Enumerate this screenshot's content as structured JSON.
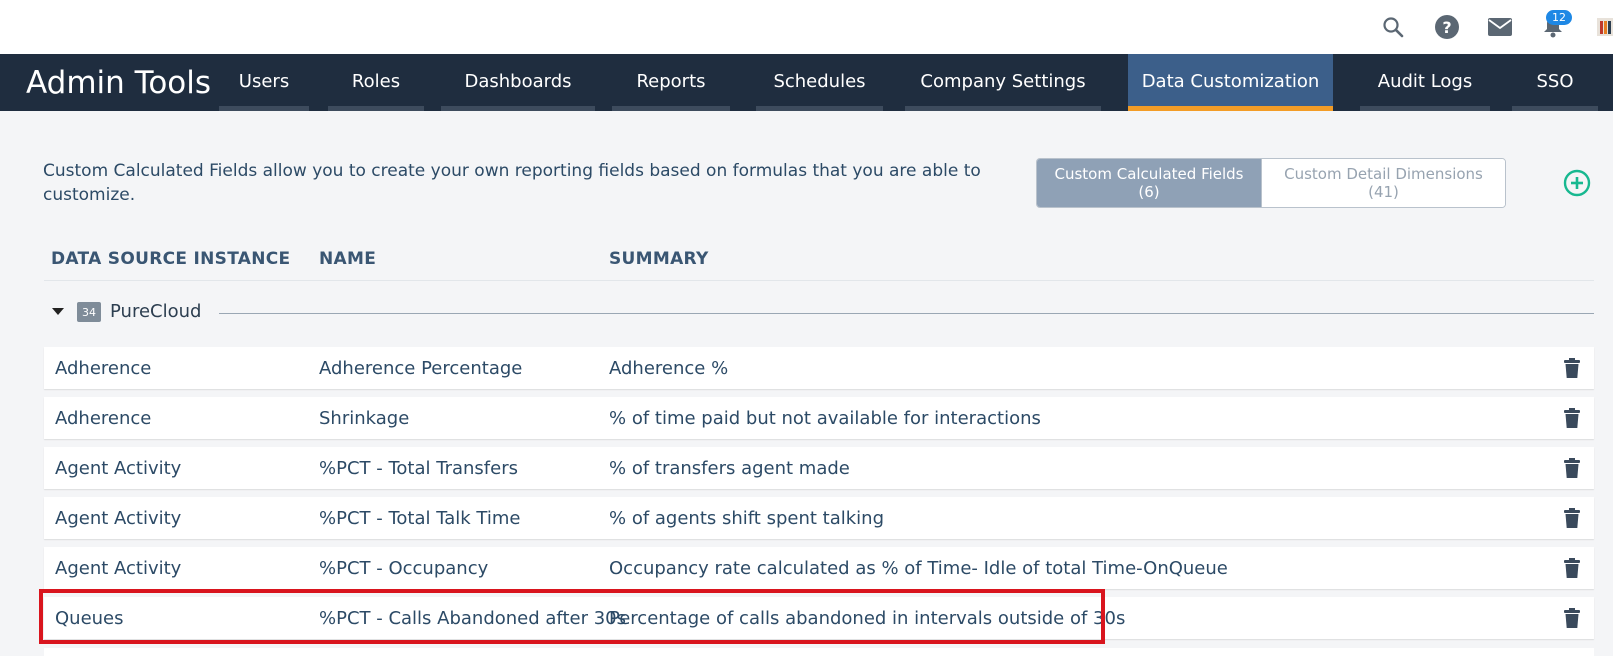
{
  "top_bar": {
    "icons": [
      "search-icon",
      "help-icon",
      "mail-icon",
      "bell-icon"
    ],
    "help_glyph": "?",
    "notification_count": "12"
  },
  "nav": {
    "app_title": "Admin Tools",
    "tabs": [
      {
        "label": "Users"
      },
      {
        "label": "Roles"
      },
      {
        "label": "Dashboards"
      },
      {
        "label": "Reports"
      },
      {
        "label": "Schedules"
      },
      {
        "label": "Company Settings"
      },
      {
        "label": "Data Customization",
        "active": true
      },
      {
        "label": "Audit Logs"
      },
      {
        "label": "SSO"
      }
    ]
  },
  "page": {
    "description": "Custom Calculated Fields allow you to create your own reporting fields based on formulas that you are able to customize.",
    "segments": [
      {
        "label": "Custom Calculated Fields",
        "count": "(6)",
        "active": true
      },
      {
        "label": "Custom Detail Dimensions",
        "count": "(41)",
        "active": false
      }
    ],
    "add_icon": "plus-circle-icon"
  },
  "table": {
    "columns": [
      "DATA SOURCE INSTANCE",
      "NAME",
      "SUMMARY"
    ],
    "group": {
      "badge": "34",
      "name": "PureCloud"
    },
    "rows": [
      {
        "source": "Adherence",
        "name": "Adherence Percentage",
        "summary": "Adherence %"
      },
      {
        "source": "Adherence",
        "name": "Shrinkage",
        "summary": "% of time paid but not available for interactions"
      },
      {
        "source": "Agent Activity",
        "name": "%PCT - Total Transfers",
        "summary": "% of transfers agent made"
      },
      {
        "source": "Agent Activity",
        "name": "%PCT - Total Talk Time",
        "summary": "% of agents shift spent talking"
      },
      {
        "source": "Agent Activity",
        "name": "%PCT - Occupancy",
        "summary": "Occupancy rate calculated as % of Time- Idle of total Time-OnQueue"
      },
      {
        "source": "Queues",
        "name": "%PCT - Calls Abandoned after 30s",
        "summary": "Percentage of calls abandoned in intervals outside of 30s"
      }
    ],
    "row_action_icon": "trash-icon"
  },
  "colors": {
    "nav_bg": "#1f2d3f",
    "active_tab_bg": "#3c5f8a",
    "active_tab_accent": "#f39c26",
    "add_button": "#17b890",
    "highlight_border": "#d9151e"
  }
}
